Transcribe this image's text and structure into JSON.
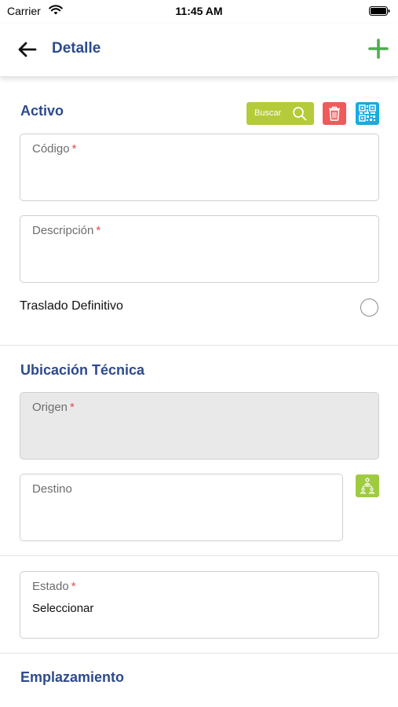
{
  "status_bar": {
    "carrier": "Carrier",
    "time": "11:45 AM"
  },
  "header": {
    "title": "Detalle"
  },
  "activo": {
    "title": "Activo",
    "search_label": "Buscar",
    "codigo_label": "Código",
    "descripcion_label": "Descripción",
    "required_mark": "*",
    "traslado_label": "Traslado Definitivo"
  },
  "ubicacion": {
    "title": "Ubicación Técnica",
    "origen_label": "Origen",
    "destino_label": "Destino"
  },
  "estado": {
    "label": "Estado",
    "value": "Seleccionar"
  },
  "emplazamiento": {
    "title": "Emplazamiento"
  },
  "colors": {
    "title_blue": "#2d4a8c",
    "add_green": "#4cae4c",
    "search_green": "#b5cb3a",
    "delete_red": "#f05a5a",
    "qr_blue": "#1ba9e0",
    "tree_green": "#9fcb3e",
    "required_red": "#e24a4a"
  },
  "icons": {
    "back": "arrow-left-icon",
    "add": "plus-icon",
    "search": "search-icon",
    "delete": "trash-icon",
    "qr": "qr-code-icon",
    "tree": "hierarchy-icon",
    "wifi": "wifi-icon",
    "battery": "battery-icon"
  }
}
